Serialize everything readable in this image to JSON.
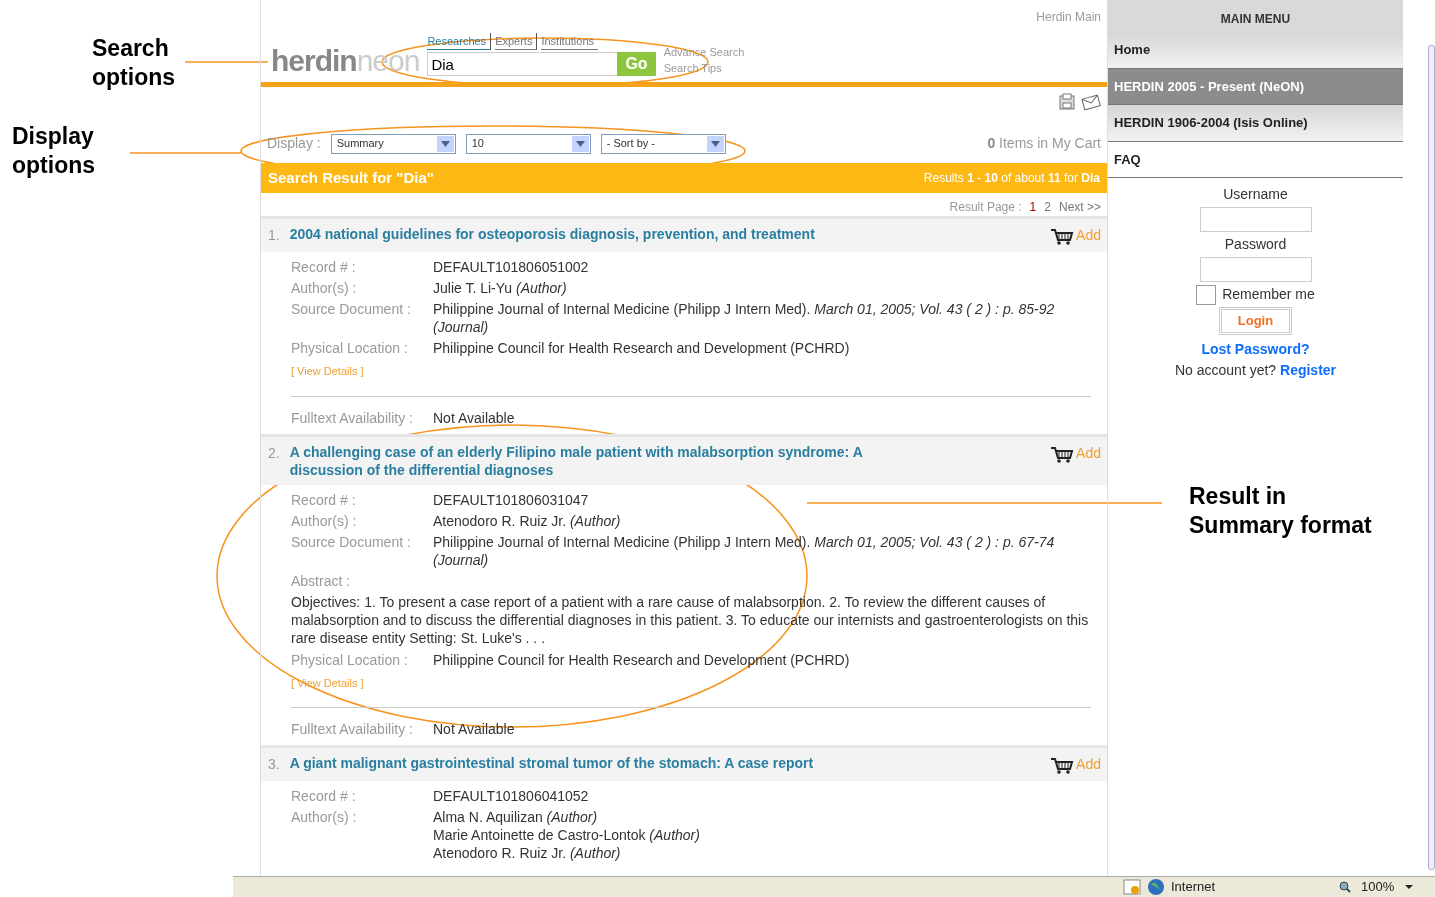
{
  "annotations": [
    {
      "text": "Search options"
    },
    {
      "text": "Display options"
    },
    {
      "text": "Result in Summary format"
    }
  ],
  "header": {
    "top_link": "Herdin Main",
    "brand": "herdin",
    "brand_suffix": "neon",
    "tabs": [
      {
        "label": "Researches",
        "selected": true
      },
      {
        "label": "Experts",
        "selected": false
      },
      {
        "label": "Institutions",
        "selected": false
      }
    ],
    "search": {
      "value": "Dia",
      "button": "Go"
    },
    "links": [
      "Advance Search",
      "Search Tips"
    ]
  },
  "display": {
    "label": "Display :",
    "selects": [
      "Summary",
      "10",
      "- Sort by -"
    ],
    "cart_count": "0",
    "cart_label": "Items in My Cart"
  },
  "result_bar": {
    "title": "Search Result for  \"Dia\"",
    "summary": "Results **1** - **10** of about **11** for **Dia**"
  },
  "pager": {
    "label": "Result Page :",
    "pages": [
      {
        "label": "1",
        "selected": true
      },
      {
        "label": "2",
        "selected": false
      }
    ],
    "next": "Next >>"
  },
  "results": [
    {
      "number": "1.",
      "title": "2004 national guidelines for osteoporosis diagnosis, prevention, and treatment",
      "add": "Add",
      "fields": [
        {
          "kind": "text",
          "label": "Record # :",
          "value": "DEFAULT101806051002"
        },
        {
          "kind": "authors",
          "label": "Author(s) :",
          "authors": [
            {
              "name": "Julie T. Li-Yu",
              "role": "(Author)"
            }
          ]
        },
        {
          "kind": "source",
          "label": "Source Document :",
          "value": "Philippine Journal of Internal Medicine (Philipp J Intern Med).",
          "detail": "March 01, 2005; Vol. 43 ( 2 ) : p. 85-92  (Journal)"
        },
        {
          "kind": "text",
          "label": "Physical Location :",
          "value": "Philippine Council for Health Research and Development (PCHRD)"
        }
      ],
      "view_details": "[ View Details ]",
      "fulltext_label": "Fulltext Availability :",
      "fulltext": "Not Available"
    },
    {
      "number": "2.",
      "title": "A challenging case of an elderly Filipino male patient with malabsorption syndrome: A discussion of the differential diagnoses",
      "add": "Add",
      "fields": [
        {
          "kind": "text",
          "label": "Record # :",
          "value": "DEFAULT101806031047"
        },
        {
          "kind": "authors",
          "label": "Author(s) :",
          "authors": [
            {
              "name": "Atenodoro R. Ruiz Jr.",
              "role": "(Author)"
            }
          ]
        },
        {
          "kind": "source",
          "label": "Source Document :",
          "value": "Philippine Journal of Internal Medicine (Philipp J Intern Med).",
          "detail": "March 01, 2005; Vol. 43 ( 2 ) : p. 67-74  (Journal)"
        },
        {
          "kind": "abstract",
          "label": "Abstract :",
          "value": "Objectives: 1. To present a case report of a patient with a rare cause of malabsorption. 2. To review the different causes of malabsorption and to discuss the differential diagnoses in this patient. 3. To educate our internists and gastroenterologists on this rare disease entity Setting: St. Luke's . . ."
        },
        {
          "kind": "text",
          "label": "Physical Location :",
          "value": "Philippine Council for Health Research and Development (PCHRD)"
        }
      ],
      "view_details": "[ View Details ]",
      "fulltext_label": "Fulltext Availability :",
      "fulltext": "Not Available"
    },
    {
      "number": "3.",
      "title": "A giant malignant gastrointestinal stromal tumor of the stomach: A case report",
      "add": "Add",
      "fields": [
        {
          "kind": "text",
          "label": "Record # :",
          "value": "DEFAULT101806041052"
        },
        {
          "kind": "authors",
          "label": "Author(s) :",
          "authors": [
            {
              "name": "Alma N. Aquilizan",
              "role": "(Author)"
            },
            {
              "name": "Marie Antoinette de Castro-Lontok",
              "role": "(Author)"
            },
            {
              "name": "Atenodoro R. Ruiz Jr.",
              "role": "(Author)"
            }
          ]
        }
      ]
    }
  ],
  "sidebar": {
    "title": "MAIN MENU",
    "items": [
      {
        "label": "Home",
        "selected": false
      },
      {
        "label": "HERDIN 2005 - Present (NeON)",
        "selected": true
      },
      {
        "label": "HERDIN 1906-2004 (Isis Online)",
        "selected": false
      },
      {
        "label": "FAQ",
        "selected": false
      }
    ],
    "login": {
      "username_label": "Username",
      "password_label": "Password",
      "remember": {
        "label": "Remember me",
        "checked": false
      },
      "button": "Login",
      "lost": "Lost Password?",
      "no_account": "No account yet?",
      "register": "Register"
    }
  },
  "status_bar": {
    "zone": "Internet",
    "zoom": "100%"
  }
}
